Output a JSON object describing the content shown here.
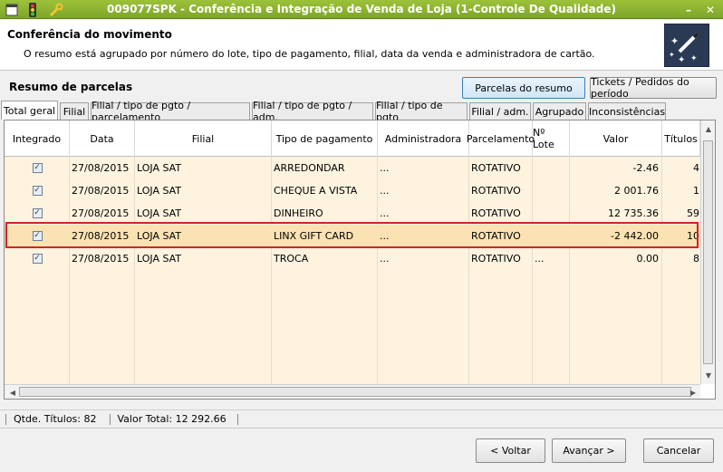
{
  "window": {
    "title": "009077SPK - Conferência e Integração de Venda de Loja (1-Controle De Qualidade)",
    "minimize": "–",
    "close": "✕"
  },
  "header": {
    "title": "Conferência do movimento",
    "subtitle": "O resumo está agrupado por número do lote, tipo de pagamento, filial, data da venda e administradora de cartão."
  },
  "section": {
    "label": "Resumo de parcelas",
    "btn_parcelas": "Parcelas do resumo",
    "btn_tickets": "Tickets / Pedidos do período"
  },
  "tabs": [
    "Total geral",
    "Filial",
    "Filial / tipo de pgto / parcelamento",
    "Filial / tipo de pgto / adm.",
    "Filial / tipo de pgto",
    "Filial / adm.",
    "Agrupado",
    "Inconsistências"
  ],
  "grid": {
    "columns": [
      "Integrado",
      "Data",
      "Filial",
      "Tipo de pagamento",
      "Administradora",
      "Parcelamento",
      "Nº Lote",
      "Valor",
      "Títulos"
    ],
    "rows": [
      {
        "integrado": "✓",
        "data": "27/08/2015",
        "filial": "LOJA SAT",
        "tipo": "ARREDONDAR",
        "adm": "...",
        "parc": "ROTATIVO",
        "lote": "",
        "valor": "-2.46",
        "titulos": "4"
      },
      {
        "integrado": "✓",
        "data": "27/08/2015",
        "filial": "LOJA SAT",
        "tipo": "CHEQUE A VISTA",
        "adm": "...",
        "parc": "ROTATIVO",
        "lote": "",
        "valor": "2 001.76",
        "titulos": "1"
      },
      {
        "integrado": "✓",
        "data": "27/08/2015",
        "filial": "LOJA SAT",
        "tipo": "DINHEIRO",
        "adm": "...",
        "parc": "ROTATIVO",
        "lote": "",
        "valor": "12 735.36",
        "titulos": "59"
      },
      {
        "integrado": "✓",
        "data": "27/08/2015",
        "filial": "LOJA SAT",
        "tipo": "LINX GIFT CARD",
        "adm": "...",
        "parc": "ROTATIVO",
        "lote": "",
        "valor": "-2 442.00",
        "titulos": "10"
      },
      {
        "integrado": "✓",
        "data": "27/08/2015",
        "filial": "LOJA SAT",
        "tipo": "TROCA",
        "adm": "...",
        "parc": "ROTATIVO",
        "lote": "...",
        "valor": "0.00",
        "titulos": "8"
      }
    ]
  },
  "status": {
    "qtde": "Qtde. Títulos:  82",
    "total": "Valor Total:  12 292.66"
  },
  "footer": {
    "back": "< Voltar",
    "next": "Avançar >",
    "cancel": "Cancelar"
  },
  "colors": {
    "titlebar": "#8db531",
    "row_bg": "#fdf3df",
    "row_selected": "#fbe2b2",
    "selection_border": "#d2232a"
  }
}
